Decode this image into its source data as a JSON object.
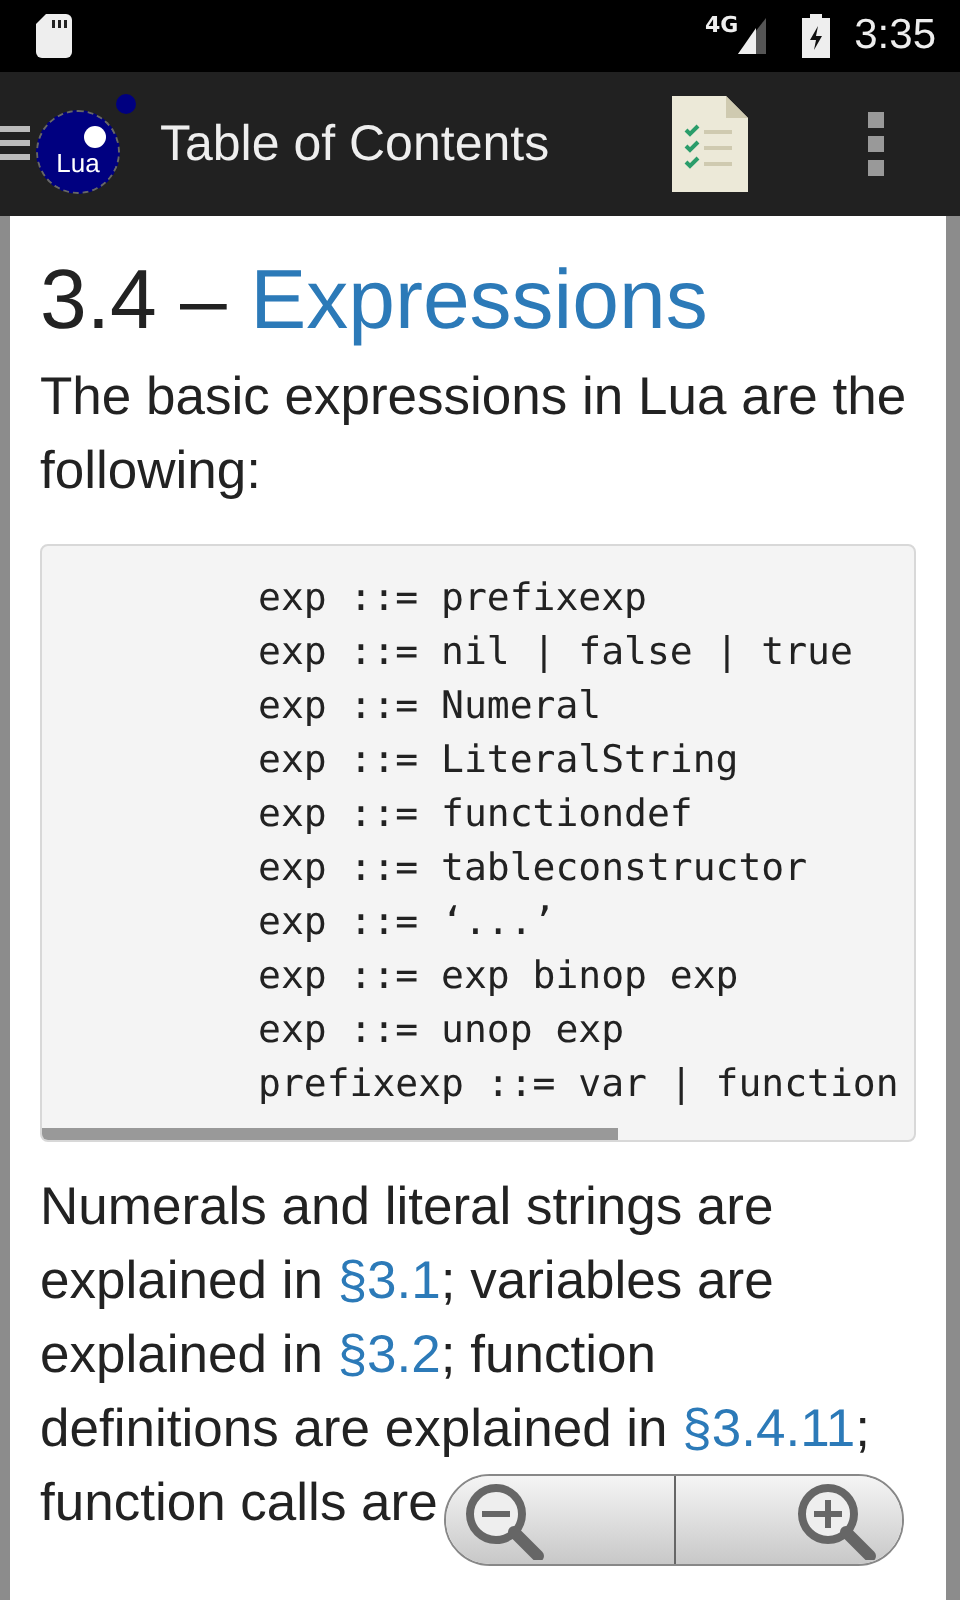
{
  "status_bar": {
    "network": "4G",
    "time": "3:35"
  },
  "app_bar": {
    "logo_text": "Lua",
    "title": "Table of Contents"
  },
  "heading": {
    "number": "3.4 –",
    "title": "Expressions"
  },
  "intro": "The basic expressions in Lua are the following:",
  "code": {
    "lines": [
      "exp ::= prefixexp",
      "exp ::= nil | false | true",
      "exp ::= Numeral",
      "exp ::= LiteralString",
      "exp ::= functiondef",
      "exp ::= tableconstructor",
      "exp ::= ‘...’",
      "exp ::= exp binop exp",
      "exp ::= unop exp",
      "prefixexp ::= var | function"
    ]
  },
  "paragraph": [
    {
      "kind": "text",
      "text": "Numerals and literal strings are explained in "
    },
    {
      "kind": "link",
      "text": "§3.1"
    },
    {
      "kind": "text",
      "text": "; variables are explained in "
    },
    {
      "kind": "link",
      "text": "§3.2"
    },
    {
      "kind": "text",
      "text": "; function definitions are explained in "
    },
    {
      "kind": "link",
      "text": "§3.4.11"
    },
    {
      "kind": "text",
      "text": "; function calls are"
    }
  ]
}
